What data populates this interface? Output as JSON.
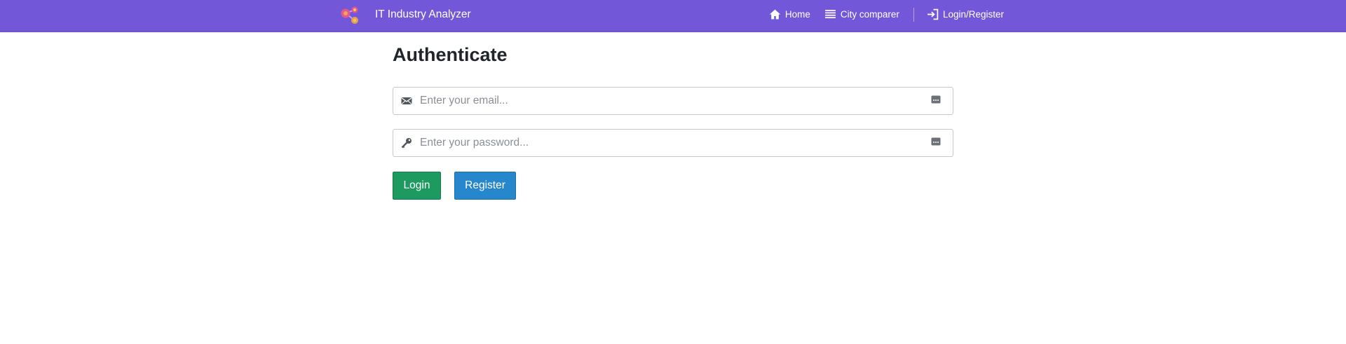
{
  "navbar": {
    "brand": "IT Industry Analyzer",
    "links": {
      "home": "Home",
      "city_comparer": "City comparer",
      "login_register": "Login/Register"
    },
    "background": "#7258d9"
  },
  "page": {
    "title": "Authenticate"
  },
  "form": {
    "email": {
      "placeholder": "Enter your email...",
      "value": ""
    },
    "password": {
      "placeholder": "Enter your password...",
      "value": ""
    },
    "login_label": "Login",
    "register_label": "Register"
  },
  "icons": {
    "brand": "molecule-logo-icon",
    "home": "home-icon",
    "city_comparer": "list-icon",
    "login": "sign-in-icon",
    "email": "envelope-icon",
    "password": "key-icon",
    "field_trailing": "password-manager-icon"
  },
  "colors": {
    "login_button": "#1d9a60",
    "register_button": "#2687cd"
  }
}
